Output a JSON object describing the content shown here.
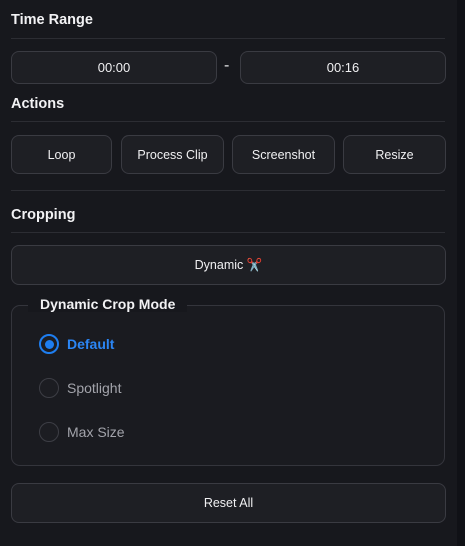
{
  "time_range": {
    "title": "Time Range",
    "start": "00:00",
    "separator": "-",
    "end": "00:16"
  },
  "actions": {
    "title": "Actions",
    "buttons": [
      "Loop",
      "Process Clip",
      "Screenshot",
      "Resize"
    ]
  },
  "cropping": {
    "title": "Cropping",
    "mode_button": "Dynamic ✂️"
  },
  "crop_mode": {
    "legend": "Dynamic Crop Mode",
    "options": [
      {
        "label": "Default",
        "checked": true
      },
      {
        "label": "Spotlight",
        "checked": false
      },
      {
        "label": "Max Size",
        "checked": false
      }
    ]
  },
  "reset_button": "Reset All",
  "colors": {
    "accent": "#1e7ef0",
    "background": "#17181d",
    "button_bg": "#1e1f24",
    "border": "#3a3b42"
  }
}
